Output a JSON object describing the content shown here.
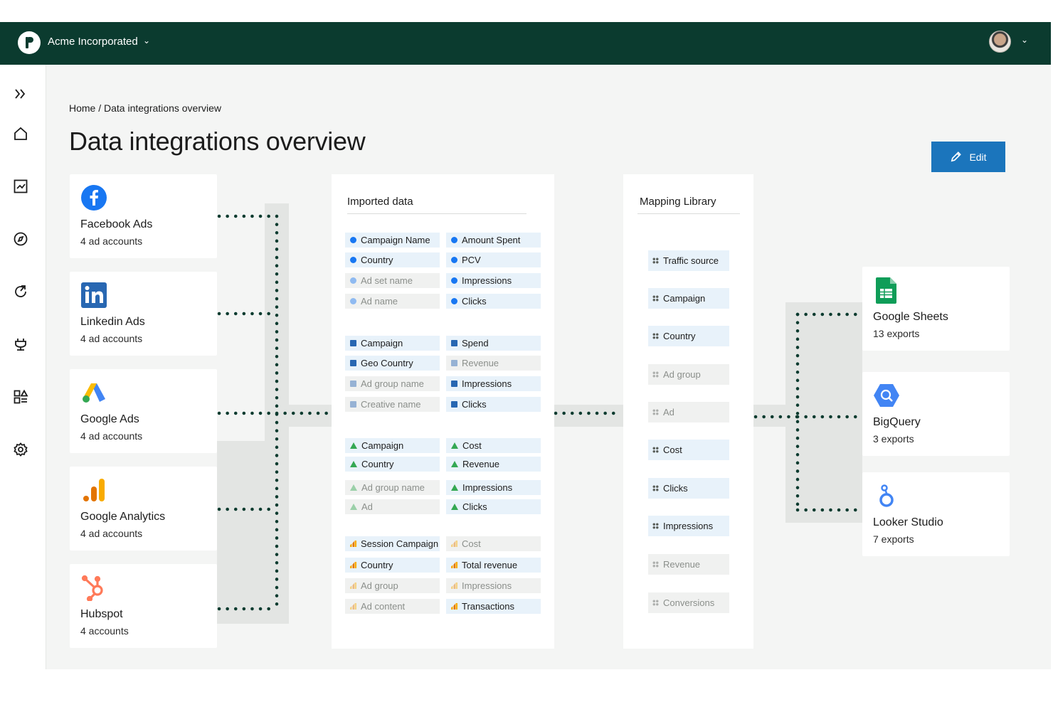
{
  "header": {
    "org_name": "Acme Incorporated",
    "user_menu": "user-avatar"
  },
  "sidebar": {
    "items": [
      "expand-icon",
      "home-icon",
      "chart-icon",
      "compass-icon",
      "refresh-icon",
      "plug-icon",
      "widgets-icon",
      "gear-icon"
    ]
  },
  "breadcrumb": "Home / Data integrations overview",
  "page_title": "Data integrations overview",
  "edit_label": "Edit",
  "sources": [
    {
      "name": "Facebook Ads",
      "sub": "4 ad accounts",
      "icon": "facebook-icon"
    },
    {
      "name": "Linkedin Ads",
      "sub": "4 ad accounts",
      "icon": "linkedin-icon"
    },
    {
      "name": "Google Ads",
      "sub": "4 ad accounts",
      "icon": "google-ads-icon"
    },
    {
      "name": "Google Analytics",
      "sub": "4 ad accounts",
      "icon": "google-analytics-icon"
    },
    {
      "name": "Hubspot",
      "sub": "4 accounts",
      "icon": "hubspot-icon"
    }
  ],
  "imported": {
    "title": "Imported data",
    "groups": [
      {
        "source": "facebook",
        "left": [
          [
            "Campaign Name",
            true
          ],
          [
            "Country",
            true
          ],
          [
            "Ad set name",
            false
          ],
          [
            "Ad name",
            false
          ]
        ],
        "right": [
          [
            "Amount Spent",
            true
          ],
          [
            "PCV",
            true
          ],
          [
            "Impressions",
            true
          ],
          [
            "Clicks",
            true
          ]
        ]
      },
      {
        "source": "linkedin",
        "left": [
          [
            "Campaign",
            true
          ],
          [
            "Geo Country",
            true
          ],
          [
            "Ad group name",
            false
          ],
          [
            "Creative name",
            false
          ]
        ],
        "right": [
          [
            "Spend",
            true
          ],
          [
            "Revenue",
            false
          ],
          [
            "Impressions",
            true
          ],
          [
            "Clicks",
            true
          ]
        ]
      },
      {
        "source": "google-ads",
        "left": [
          [
            "Campaign",
            true
          ],
          [
            "Country",
            true
          ],
          [
            "Ad group name",
            false
          ],
          [
            "Ad",
            false
          ]
        ],
        "right": [
          [
            "Cost",
            true
          ],
          [
            "Revenue",
            true
          ],
          [
            "Impressions",
            true
          ],
          [
            "Clicks",
            true
          ]
        ]
      },
      {
        "source": "analytics",
        "left": [
          [
            "Session Campaign",
            true
          ],
          [
            "Country",
            true
          ],
          [
            "Ad group",
            false
          ],
          [
            "Ad content",
            false
          ]
        ],
        "right": [
          [
            "Cost",
            false
          ],
          [
            "Total revenue",
            true
          ],
          [
            "Impressions",
            false
          ],
          [
            "Transactions",
            true
          ]
        ]
      }
    ]
  },
  "mapping": {
    "title": "Mapping Library",
    "items": [
      [
        "Traffic source",
        true
      ],
      [
        "Campaign",
        true
      ],
      [
        "Country",
        true
      ],
      [
        "Ad group",
        false
      ],
      [
        "Ad",
        false
      ],
      [
        "Cost",
        true
      ],
      [
        "Clicks",
        true
      ],
      [
        "Impressions",
        true
      ],
      [
        "Revenue",
        false
      ],
      [
        "Conversions",
        false
      ]
    ]
  },
  "destinations": [
    {
      "name": "Google Sheets",
      "sub": "13 exports",
      "icon": "google-sheets-icon"
    },
    {
      "name": "BigQuery",
      "sub": "3 exports",
      "icon": "bigquery-icon"
    },
    {
      "name": "Looker Studio",
      "sub": "7 exports",
      "icon": "looker-studio-icon"
    }
  ],
  "colors": {
    "topbar": "#0b3b2f",
    "accent": "#1b75bc",
    "dots": "#0b3b2f"
  }
}
